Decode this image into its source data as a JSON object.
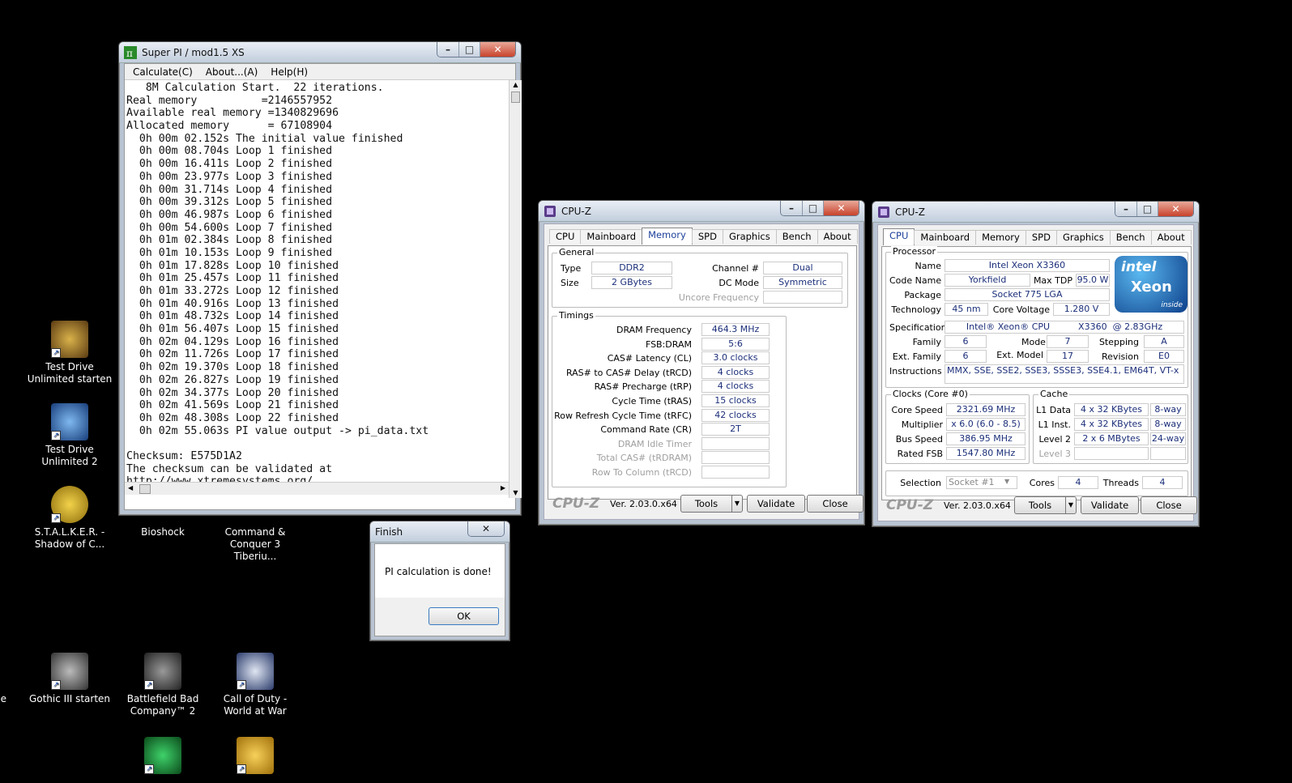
{
  "desktop": {
    "icons": [
      {
        "label": "Test Drive Unlimited starten",
        "color": "#8a6a2a"
      },
      {
        "label": "Test Drive Unlimited 2",
        "color": "#1d5ea8"
      },
      {
        "label": "S.T.A.L.K.E.R. - Shadow of C...",
        "color": "#c9a21c"
      },
      {
        "label": "Bioshock",
        "color": "#6b4a2a"
      },
      {
        "label": "Command & Conquer 3 Tiberiu...",
        "color": "#2c7d3b"
      },
      {
        "label": "Gothic III starten",
        "color": "#555555"
      },
      {
        "label": "Battlefield Bad Company™ 2",
        "color": "#4a4a4a"
      },
      {
        "label": "Call of Duty - World at War",
        "color": "#2a3a6a"
      },
      {
        "label": "e",
        "color": "#000000"
      }
    ]
  },
  "superpi": {
    "title": "Super PI / mod1.5 XS",
    "menu": [
      "Calculate(C)",
      "About...(A)",
      "Help(H)"
    ],
    "lines": [
      "   8M Calculation Start.  22 iterations.",
      "Real memory          =2146557952",
      "Available real memory =1340829696",
      "Allocated memory      = 67108904",
      "  0h 00m 02.152s The initial value finished",
      "  0h 00m 08.704s Loop 1 finished",
      "  0h 00m 16.411s Loop 2 finished",
      "  0h 00m 23.977s Loop 3 finished",
      "  0h 00m 31.714s Loop 4 finished",
      "  0h 00m 39.312s Loop 5 finished",
      "  0h 00m 46.987s Loop 6 finished",
      "  0h 00m 54.600s Loop 7 finished",
      "  0h 01m 02.384s Loop 8 finished",
      "  0h 01m 10.153s Loop 9 finished",
      "  0h 01m 17.828s Loop 10 finished",
      "  0h 01m 25.457s Loop 11 finished",
      "  0h 01m 33.272s Loop 12 finished",
      "  0h 01m 40.916s Loop 13 finished",
      "  0h 01m 48.732s Loop 14 finished",
      "  0h 01m 56.407s Loop 15 finished",
      "  0h 02m 04.129s Loop 16 finished",
      "  0h 02m 11.726s Loop 17 finished",
      "  0h 02m 19.370s Loop 18 finished",
      "  0h 02m 26.827s Loop 19 finished",
      "  0h 02m 34.377s Loop 20 finished",
      "  0h 02m 41.569s Loop 21 finished",
      "  0h 02m 48.308s Loop 22 finished",
      "  0h 02m 55.063s PI value output -> pi_data.txt",
      "",
      "Checksum: E575D1A2",
      "The checksum can be validated at",
      "http://www.xtremesystems.org/"
    ]
  },
  "finish": {
    "title": "Finish",
    "message": "PI calculation is done!",
    "ok": "OK"
  },
  "cpuz_common": {
    "title": "CPU-Z",
    "tabs": [
      "CPU",
      "Mainboard",
      "Memory",
      "SPD",
      "Graphics",
      "Bench",
      "About"
    ],
    "logo": "CPU-Z",
    "version": "Ver. 2.03.0.x64",
    "tools": "Tools",
    "validate": "Validate",
    "close": "Close"
  },
  "memory": {
    "general_label": "General",
    "type_label": "Type",
    "type": "DDR2",
    "size_label": "Size",
    "size": "2 GBytes",
    "channel_label": "Channel #",
    "channel": "Dual",
    "dcmode_label": "DC Mode",
    "dcmode": "Symmetric",
    "uncore_label": "Uncore Frequency",
    "uncore": "",
    "timings_label": "Timings",
    "rows": [
      {
        "label": "DRAM Frequency",
        "value": "464.3 MHz",
        "dis": false
      },
      {
        "label": "FSB:DRAM",
        "value": "5:6",
        "dis": false
      },
      {
        "label": "CAS# Latency (CL)",
        "value": "3.0 clocks",
        "dis": false
      },
      {
        "label": "RAS# to CAS# Delay (tRCD)",
        "value": "4 clocks",
        "dis": false
      },
      {
        "label": "RAS# Precharge (tRP)",
        "value": "4 clocks",
        "dis": false
      },
      {
        "label": "Cycle Time (tRAS)",
        "value": "15 clocks",
        "dis": false
      },
      {
        "label": "Row Refresh Cycle Time (tRFC)",
        "value": "42 clocks",
        "dis": false
      },
      {
        "label": "Command Rate (CR)",
        "value": "2T",
        "dis": false
      },
      {
        "label": "DRAM Idle Timer",
        "value": "",
        "dis": true
      },
      {
        "label": "Total CAS# (tRDRAM)",
        "value": "",
        "dis": true
      },
      {
        "label": "Row To Column (tRCD)",
        "value": "",
        "dis": true
      }
    ]
  },
  "cpu": {
    "processor_label": "Processor",
    "name_label": "Name",
    "name": "Intel Xeon X3360",
    "codename_label": "Code Name",
    "codename": "Yorkfield",
    "maxtdp_label": "Max TDP",
    "maxtdp": "95.0 W",
    "package_label": "Package",
    "package": "Socket 775 LGA",
    "tech_label": "Technology",
    "tech": "45 nm",
    "voltage_label": "Core Voltage",
    "voltage": "1.280 V",
    "spec_label": "Specification",
    "spec": "Intel® Xeon® CPU          X3360  @ 2.83GHz",
    "family_label": "Family",
    "family": "6",
    "model_label": "Model",
    "model": "7",
    "stepping_label": "Stepping",
    "stepping": "A",
    "extfamily_label": "Ext. Family",
    "extfamily": "6",
    "extmodel_label": "Ext. Model",
    "extmodel": "17",
    "revision_label": "Revision",
    "revision": "E0",
    "instr_label": "Instructions",
    "instr": "MMX, SSE, SSE2, SSE3, SSSE3, SSE4.1, EM64T, VT-x",
    "clocks_label": "Clocks (Core #0)",
    "corespeed_label": "Core Speed",
    "corespeed": "2321.69 MHz",
    "mult_label": "Multiplier",
    "mult": "x 6.0 (6.0 - 8.5)",
    "bus_label": "Bus Speed",
    "bus": "386.95 MHz",
    "fsb_label": "Rated FSB",
    "fsb": "1547.80 MHz",
    "cache_label": "Cache",
    "l1d_label": "L1 Data",
    "l1d": "4 x 32 KBytes",
    "l1d_way": "8-way",
    "l1i_label": "L1 Inst.",
    "l1i": "4 x 32 KBytes",
    "l1i_way": "8-way",
    "l2_label": "Level 2",
    "l2": "2 x 6 MBytes",
    "l2_way": "24-way",
    "l3_label": "Level 3",
    "l3": "",
    "l3_way": "",
    "selection_label": "Selection",
    "selection": "Socket #1",
    "cores_label": "Cores",
    "cores": "4",
    "threads_label": "Threads",
    "threads": "4",
    "logo_intel": "intel",
    "logo_xeon": "Xeon",
    "logo_inside": "inside"
  }
}
